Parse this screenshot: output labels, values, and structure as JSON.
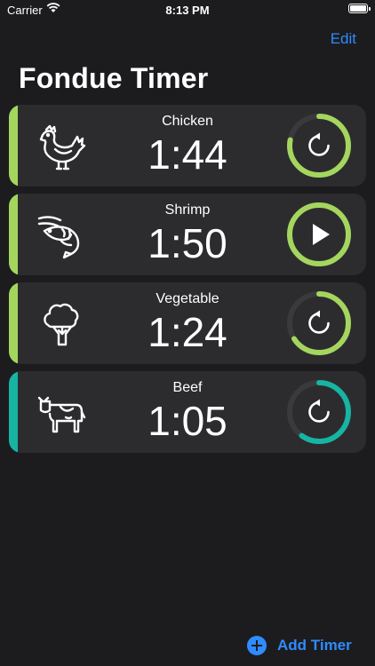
{
  "status_bar": {
    "carrier": "Carrier",
    "time": "8:13 PM"
  },
  "header": {
    "edit_label": "Edit",
    "title": "Fondue Timer"
  },
  "timers": [
    {
      "name": "Chicken",
      "remaining": "1:44",
      "icon": "chicken-icon",
      "accent": "#a4d65e",
      "progress": 0.78,
      "state": "running"
    },
    {
      "name": "Shrimp",
      "remaining": "1:50",
      "icon": "shrimp-icon",
      "accent": "#a4d65e",
      "progress": 1.0,
      "state": "paused"
    },
    {
      "name": "Vegetable",
      "remaining": "1:24",
      "icon": "broccoli-icon",
      "accent": "#a4d65e",
      "progress": 0.66,
      "state": "running"
    },
    {
      "name": "Beef",
      "remaining": "1:05",
      "icon": "cow-icon",
      "accent": "#17b3a3",
      "progress": 0.6,
      "state": "running"
    }
  ],
  "footer": {
    "add_timer_label": "Add Timer"
  },
  "colors": {
    "background": "#1c1c1e",
    "card": "#2c2c2e",
    "link": "#2f8bff",
    "ring_track": "#3a3a3c"
  }
}
